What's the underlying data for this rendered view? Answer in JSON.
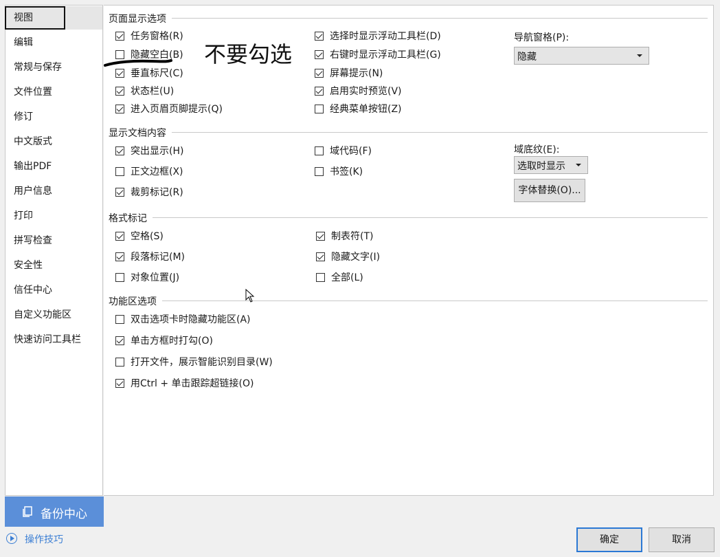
{
  "sidebar": {
    "items": [
      {
        "label": "视图",
        "selected": true
      },
      {
        "label": "编辑"
      },
      {
        "label": "常规与保存"
      },
      {
        "label": "文件位置"
      },
      {
        "label": "修订"
      },
      {
        "label": "中文版式"
      },
      {
        "label": "输出PDF"
      },
      {
        "label": "用户信息"
      },
      {
        "label": "打印"
      },
      {
        "label": "拼写检查"
      },
      {
        "label": "安全性"
      },
      {
        "label": "信任中心"
      },
      {
        "label": "自定义功能区"
      },
      {
        "label": "快速访问工具栏"
      }
    ],
    "backup_label": "备份中心",
    "backup_icon": "backup-icon",
    "tips_label": "操作技巧",
    "tips_icon": "play-circle-icon"
  },
  "sections": {
    "page_display": {
      "title": "页面显示选项",
      "col1": [
        {
          "label": "任务窗格(R)",
          "checked": true
        },
        {
          "label": "隐藏空白(B)",
          "checked": false
        },
        {
          "label": "垂直标尺(C)",
          "checked": true
        },
        {
          "label": "状态栏(U)",
          "checked": true
        },
        {
          "label": "进入页眉页脚提示(Q)",
          "checked": true
        }
      ],
      "col2": [
        {
          "label": "选择时显示浮动工具栏(D)",
          "checked": true
        },
        {
          "label": "右键时显示浮动工具栏(G)",
          "checked": true
        },
        {
          "label": "屏幕提示(N)",
          "checked": true
        },
        {
          "label": "启用实时预览(V)",
          "checked": true
        },
        {
          "label": "经典菜单按钮(Z)",
          "checked": false
        }
      ],
      "nav_label": "导航窗格(P):",
      "nav_value": "隐藏"
    },
    "doc_content": {
      "title": "显示文档内容",
      "col1": [
        {
          "label": "突出显示(H)",
          "checked": true
        },
        {
          "label": "正文边框(X)",
          "checked": false
        },
        {
          "label": "裁剪标记(R)",
          "checked": true
        }
      ],
      "col2": [
        {
          "label": "域代码(F)",
          "checked": false
        },
        {
          "label": "书签(K)",
          "checked": false
        }
      ],
      "shading_label": "域底纹(E):",
      "shading_value": "选取时显示",
      "font_sub_button": "字体替换(O)..."
    },
    "format_marks": {
      "title": "格式标记",
      "col1": [
        {
          "label": "空格(S)",
          "checked": true
        },
        {
          "label": "段落标记(M)",
          "checked": true
        },
        {
          "label": "对象位置(J)",
          "checked": false
        }
      ],
      "col2": [
        {
          "label": "制表符(T)",
          "checked": true
        },
        {
          "label": "隐藏文字(I)",
          "checked": true
        },
        {
          "label": "全部(L)",
          "checked": false
        }
      ]
    },
    "ribbon": {
      "title": "功能区选项",
      "items": [
        {
          "label": "双击选项卡时隐藏功能区(A)",
          "checked": false
        },
        {
          "label": "单击方框时打勾(O)",
          "checked": true
        },
        {
          "label": "打开文件，展示智能识别目录(W)",
          "checked": false
        },
        {
          "label": "用Ctrl + 单击跟踪超链接(O)",
          "checked": true
        }
      ]
    }
  },
  "annotation": {
    "text": "不要勾选"
  },
  "footer": {
    "ok_label": "确定",
    "cancel_label": "取消"
  }
}
